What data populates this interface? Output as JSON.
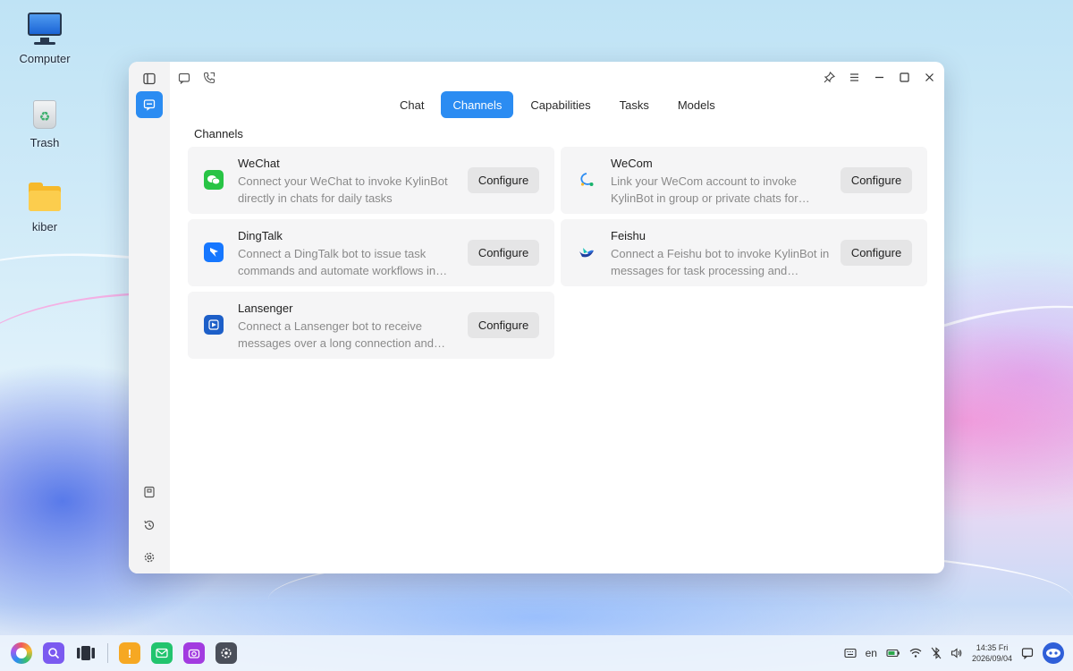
{
  "desktop": {
    "icons": [
      {
        "label": "Computer"
      },
      {
        "label": "Trash"
      },
      {
        "label": "kiber"
      }
    ]
  },
  "window": {
    "tabs": [
      {
        "label": "Chat"
      },
      {
        "label": "Channels",
        "active": true
      },
      {
        "label": "Capabilities"
      },
      {
        "label": "Tasks"
      },
      {
        "label": "Models"
      }
    ],
    "section_title": "Channels",
    "configure_label": "Configure",
    "channels": [
      {
        "name": "WeChat",
        "icon": "wechat-icon",
        "color": "#28c445",
        "description": "Connect your WeChat to invoke KylinBot directly in chats for daily tasks"
      },
      {
        "name": "WeCom",
        "icon": "wecom-icon",
        "color": "#2b8cf2",
        "description": "Link your WeCom account to invoke KylinBot in group or private chats for team…"
      },
      {
        "name": "DingTalk",
        "icon": "dingtalk-icon",
        "color": "#1677ff",
        "description": "Connect a DingTalk bot to issue task commands and automate workflows in…"
      },
      {
        "name": "Feishu",
        "icon": "feishu-icon",
        "color": "#1f6fe5",
        "description": "Connect a Feishu bot to invoke KylinBot in messages for task processing and workflo…"
      },
      {
        "name": "Lansenger",
        "icon": "lansenger-icon",
        "color": "#1d5fc8",
        "description": "Connect a Lansenger bot to receive messages over a long connection and invo…"
      }
    ]
  },
  "taskbar": {
    "lang": "en",
    "time": "14:35 Fri",
    "date": "2026/09/04"
  }
}
